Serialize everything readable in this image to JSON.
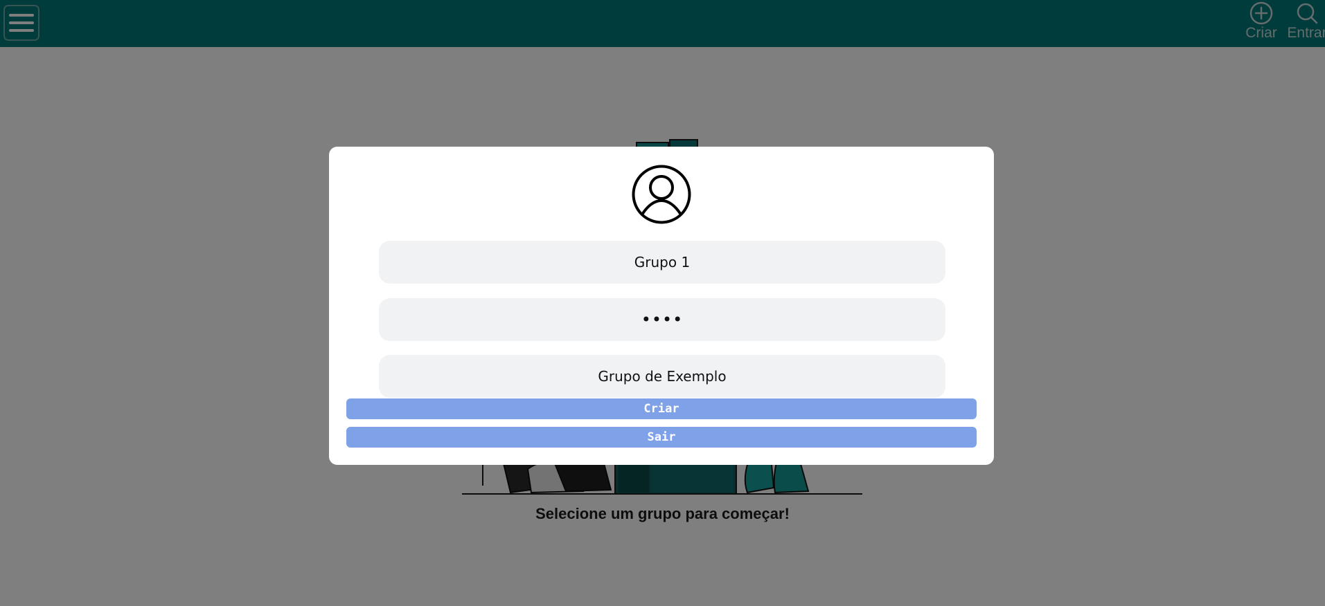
{
  "topbar": {
    "menu_icon": "hamburger-menu-icon",
    "actions": [
      {
        "label": "Criar",
        "icon": "plus-circle-icon"
      },
      {
        "label": "Entrar",
        "icon": "search-icon"
      }
    ]
  },
  "main": {
    "message": "Selecione um grupo para começar!"
  },
  "modal": {
    "avatar_icon": "user-circle-icon",
    "fields": {
      "name": {
        "value": "Grupo 1"
      },
      "password": {
        "value": "••••"
      },
      "description": {
        "value": "Grupo de Exemplo"
      }
    },
    "buttons": {
      "create_label": "Criar",
      "exit_label": "Sair"
    }
  },
  "colors": {
    "topbar_bg": "#02797a",
    "button_bg": "#7ea1e8",
    "field_bg": "#f1f2f4",
    "overlay": "rgba(0,0,0,0.5)"
  }
}
